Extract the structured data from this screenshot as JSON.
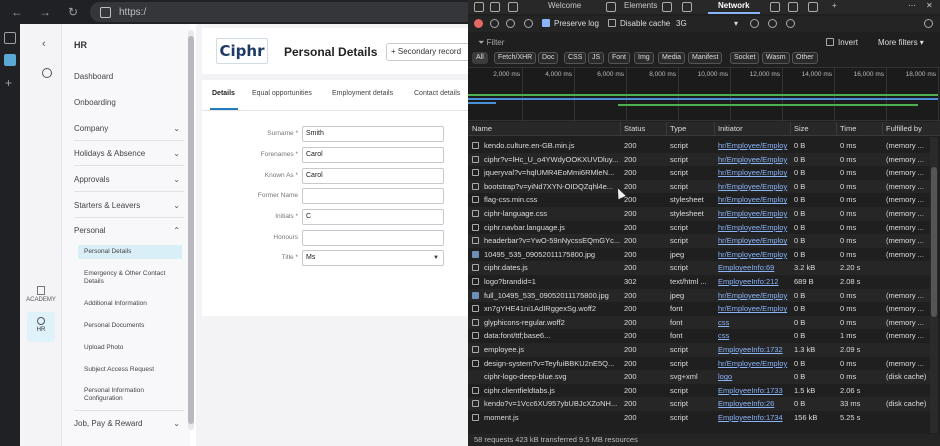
{
  "browser": {
    "url": "https:/",
    "sidebar_icons": [
      "tabs-icon",
      "ciphr-favicon-icon",
      "new-tab-icon"
    ]
  },
  "hr_app": {
    "module_title": "HR",
    "rail": {
      "academy_label": "ACADEMY",
      "hr_label": "HR"
    },
    "nav": [
      {
        "label": "Dashboard"
      },
      {
        "label": "Onboarding"
      },
      {
        "label": "Company",
        "chevron": "down"
      },
      {
        "label": "Holidays & Absence",
        "chevron": "down"
      },
      {
        "label": "Approvals",
        "chevron": "down"
      },
      {
        "label": "Starters & Leavers",
        "chevron": "down"
      },
      {
        "label": "Personal",
        "chevron": "up"
      }
    ],
    "personal_subitems": [
      {
        "label": "Personal Details",
        "active": true
      },
      {
        "label": "Emergency & Other Contact Details"
      },
      {
        "label": "Additional Information"
      },
      {
        "label": "Personal Documents"
      },
      {
        "label": "Upload Photo"
      },
      {
        "label": "Subject Access Request"
      },
      {
        "label": "Personal Information Configuration"
      }
    ],
    "nav_after": [
      {
        "label": "Job, Pay & Reward",
        "chevron": "down"
      }
    ],
    "logo_text": "Ciphr",
    "page_title": "Personal Details",
    "secondary_record_label": "+ Secondary record",
    "tabs": [
      "Details",
      "Equal opportunities",
      "Employment details",
      "Contact details"
    ],
    "fields": [
      {
        "label": "Surname *",
        "value": "Smith"
      },
      {
        "label": "Forenames *",
        "value": "Carol"
      },
      {
        "label": "Known As *",
        "value": "Carol"
      },
      {
        "label": "Former Name",
        "value": ""
      },
      {
        "label": "Initials *",
        "value": "C"
      },
      {
        "label": "Honours",
        "value": ""
      },
      {
        "label": "Title *",
        "value": "Ms",
        "type": "select"
      }
    ]
  },
  "devtools": {
    "tabs": [
      "Welcome",
      "Elements",
      "Network"
    ],
    "active_tab": "Network",
    "toolbar": {
      "preserve_log": "Preserve log",
      "disable_cache": "Disable cache",
      "throttle": "3G"
    },
    "filter_placeholder": "Filter",
    "invert_label": "Invert",
    "more_filters_label": "More filters",
    "type_filters": [
      "All",
      "Fetch/XHR",
      "Doc",
      "CSS",
      "JS",
      "Font",
      "Img",
      "Media",
      "Manifest",
      "Socket",
      "Wasm",
      "Other"
    ],
    "timeline_ticks": [
      "2,000 ms",
      "4,000 ms",
      "6,000 ms",
      "8,000 ms",
      "10,000 ms",
      "12,000 ms",
      "14,000 ms",
      "16,000 ms",
      "18,000 ms"
    ],
    "columns": [
      "Name",
      "Status",
      "Type",
      "Initiator",
      "Size",
      "Time",
      "Fulfilled by"
    ],
    "rows": [
      {
        "name": "kendo.culture.en-GB.min.js",
        "status": "200",
        "type": "script",
        "initiator": "hr/Employee/Employ",
        "size": "0 B",
        "time": "0 ms",
        "fulfilled": "(memory ...",
        "icon": "script"
      },
      {
        "name": "ciphr?v=lHc_U_o4YWdyOOKXUVDluy...",
        "status": "200",
        "type": "script",
        "initiator": "hr/Employee/Employ",
        "size": "0 B",
        "time": "0 ms",
        "fulfilled": "(memory ...",
        "icon": "script"
      },
      {
        "name": "jqueryval?v=hqlUMR4EoMmi6RMleN...",
        "status": "200",
        "type": "script",
        "initiator": "hr/Employee/Employ",
        "size": "0 B",
        "time": "0 ms",
        "fulfilled": "(memory ...",
        "icon": "script"
      },
      {
        "name": "bootstrap?v=yiNd7XYN-OIDQZqhl4e...",
        "status": "200",
        "type": "script",
        "initiator": "hr/Employee/Employ",
        "size": "0 B",
        "time": "0 ms",
        "fulfilled": "(memory ...",
        "icon": "script"
      },
      {
        "name": "flag-css.min.css",
        "status": "200",
        "type": "stylesheet",
        "initiator": "hr/Employee/Employ",
        "size": "0 B",
        "time": "0 ms",
        "fulfilled": "(memory ...",
        "icon": "css"
      },
      {
        "name": "ciphr-language.css",
        "status": "200",
        "type": "stylesheet",
        "initiator": "hr/Employee/Employ",
        "size": "0 B",
        "time": "0 ms",
        "fulfilled": "(memory ...",
        "icon": "css"
      },
      {
        "name": "ciphr.navbar.language.js",
        "status": "200",
        "type": "script",
        "initiator": "hr/Employee/Employ",
        "size": "0 B",
        "time": "0 ms",
        "fulfilled": "(memory ...",
        "icon": "script"
      },
      {
        "name": "headerbar?v=YwO-59nNycssEQmGYc...",
        "status": "200",
        "type": "script",
        "initiator": "hr/Employee/Employ",
        "size": "0 B",
        "time": "0 ms",
        "fulfilled": "(memory ...",
        "icon": "script"
      },
      {
        "name": "10495_535_09052011175800.jpg",
        "status": "200",
        "type": "jpeg",
        "initiator": "hr/Employee/Employ",
        "size": "0 B",
        "time": "0 ms",
        "fulfilled": "(memory ...",
        "icon": "img"
      },
      {
        "name": "ciphr.dates.js",
        "status": "200",
        "type": "script",
        "initiator": "EmployeeInfo:69",
        "size": "3.2 kB",
        "time": "2.20 s",
        "fulfilled": "",
        "icon": "script"
      },
      {
        "name": "logo?brandid=1",
        "status": "302",
        "type": "text/html ...",
        "initiator": "EmployeeInfo:212",
        "size": "689 B",
        "time": "2.08 s",
        "fulfilled": "",
        "icon": "doc"
      },
      {
        "name": "full_10495_535_09052011175800.jpg",
        "status": "200",
        "type": "jpeg",
        "initiator": "hr/Employee/Employ",
        "size": "0 B",
        "time": "0 ms",
        "fulfilled": "(memory ...",
        "icon": "img"
      },
      {
        "name": "xn7gYHE41ni1AdIRggexSg.woff2",
        "status": "200",
        "type": "font",
        "initiator": "hr/Employee/Employ",
        "size": "0 B",
        "time": "0 ms",
        "fulfilled": "(memory ...",
        "icon": "font"
      },
      {
        "name": "glyphicons-regular.woff2",
        "status": "200",
        "type": "font",
        "initiator": "css",
        "size": "0 B",
        "time": "0 ms",
        "fulfilled": "(memory ...",
        "icon": "font"
      },
      {
        "name": "data:font/ttf;base6...",
        "status": "200",
        "type": "font",
        "initiator": "css",
        "size": "0 B",
        "time": "1 ms",
        "fulfilled": "(memory ...",
        "icon": "font"
      },
      {
        "name": "employee.js",
        "status": "200",
        "type": "script",
        "initiator": "EmployeeInfo:1732",
        "size": "1.3 kB",
        "time": "2.09 s",
        "fulfilled": "",
        "icon": "script"
      },
      {
        "name": "design-system?v=TeyfuiBBKU2nE5Q...",
        "status": "200",
        "type": "script",
        "initiator": "hr/Employee/Employ",
        "size": "0 B",
        "time": "0 ms",
        "fulfilled": "(memory ...",
        "icon": "script"
      },
      {
        "name": "ciphr-logo-deep-blue.svg",
        "status": "200",
        "type": "svg+xml",
        "initiator": "logo",
        "size": "0 B",
        "time": "0 ms",
        "fulfilled": "(disk cache)",
        "icon": "none"
      },
      {
        "name": "ciphr.clientfieldtabs.js",
        "status": "200",
        "type": "script",
        "initiator": "EmployeeInfo:1733",
        "size": "1.5 kB",
        "time": "2.06 s",
        "fulfilled": "",
        "icon": "script"
      },
      {
        "name": "kendo?v=1Vcc6XU957ybUBJcXZoNH...",
        "status": "200",
        "type": "script",
        "initiator": "EmployeeInfo:26",
        "size": "0 B",
        "time": "33 ms",
        "fulfilled": "(disk cache)",
        "icon": "script"
      },
      {
        "name": "moment.js",
        "status": "200",
        "type": "script",
        "initiator": "EmployeeInfo:1734",
        "size": "156 kB",
        "time": "5.25 s",
        "fulfilled": "",
        "icon": "script"
      }
    ],
    "status_bar": "58 requests  423 kB transferred  9.5 MB resources",
    "colors": {
      "accent": "#8ab4f8",
      "record": "#e46962",
      "bar_green": "#4caf50",
      "bar_blue": "#4a8fd9"
    }
  }
}
